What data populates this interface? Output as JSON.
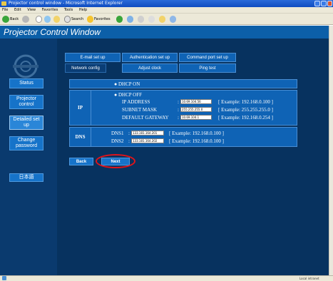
{
  "browser": {
    "title": "Projector control window - Microsoft Internet Explorer",
    "menu": [
      "File",
      "Edit",
      "View",
      "Favorites",
      "Tools",
      "Help"
    ],
    "back_label": "Back",
    "search_label": "Search",
    "favorites_label": "Favorites",
    "status_text": "Local intranet"
  },
  "app": {
    "header_title": "Projector Control Window"
  },
  "sidebar": {
    "items": [
      {
        "label": "Status"
      },
      {
        "label": "Projector control"
      },
      {
        "label": "Detailed set up"
      },
      {
        "label": "Change password"
      },
      {
        "label": "日本語"
      }
    ]
  },
  "tabs": {
    "row1": [
      "E-mail set up",
      "Authentication set up",
      "Command port set up"
    ],
    "row2": [
      "Network config",
      "Adjust clock",
      "Ping test"
    ]
  },
  "network": {
    "dhcp_on": "DHCP ON",
    "ip": {
      "label": "IP",
      "dhcp_off": "DHCP OFF",
      "fields": [
        {
          "name": "IP ADDRESS",
          "value": "10.69.104.56",
          "example": "[ Example: 192.168.0.100 ]"
        },
        {
          "name": "SUBNET MASK",
          "value": "255.255.255.0",
          "example": "[ Example: 255.255.255.0 ]"
        },
        {
          "name": "DEFAULT GATEWAY",
          "value": "10.69.104.1",
          "example": "[ Example: 192.168.0.254 ]"
        }
      ]
    },
    "dns": {
      "label": "DNS",
      "fields": [
        {
          "name": "DNS1",
          "value": "133.181.164.201",
          "example": "[ Example: 192.168.0.100 ]"
        },
        {
          "name": "DNS2",
          "value": "133.181.164.202",
          "example": "[ Example: 192.168.0.100 ]"
        }
      ]
    }
  },
  "actions": {
    "back_label": "Back",
    "next_label": "Next"
  },
  "colors": {
    "app_background": "#07325f",
    "panel": "#0f63b5",
    "highlight_ring": "#e0141a"
  }
}
